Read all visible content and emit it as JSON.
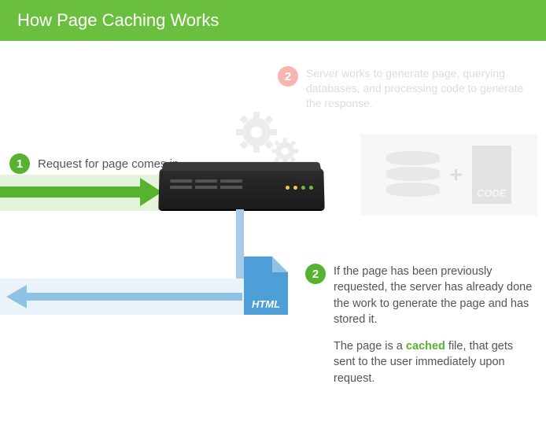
{
  "header": {
    "title": "How Page Caching Works"
  },
  "step1": {
    "badge": "1",
    "text": "Request for page comes in."
  },
  "step2_faded": {
    "badge": "2",
    "text": "Server works to generate page, querying databases, and processing code to generate the response."
  },
  "code_label": "CODE",
  "file_label": "HTML",
  "plus": "+",
  "step2": {
    "badge": "2",
    "p1": "If the page has been previously requested, the server has already done the work to generate the page and has stored it.",
    "p2_a": "The page is a ",
    "p2_cached": "cached",
    "p2_b": " file, that gets sent to the user immediately upon request."
  }
}
